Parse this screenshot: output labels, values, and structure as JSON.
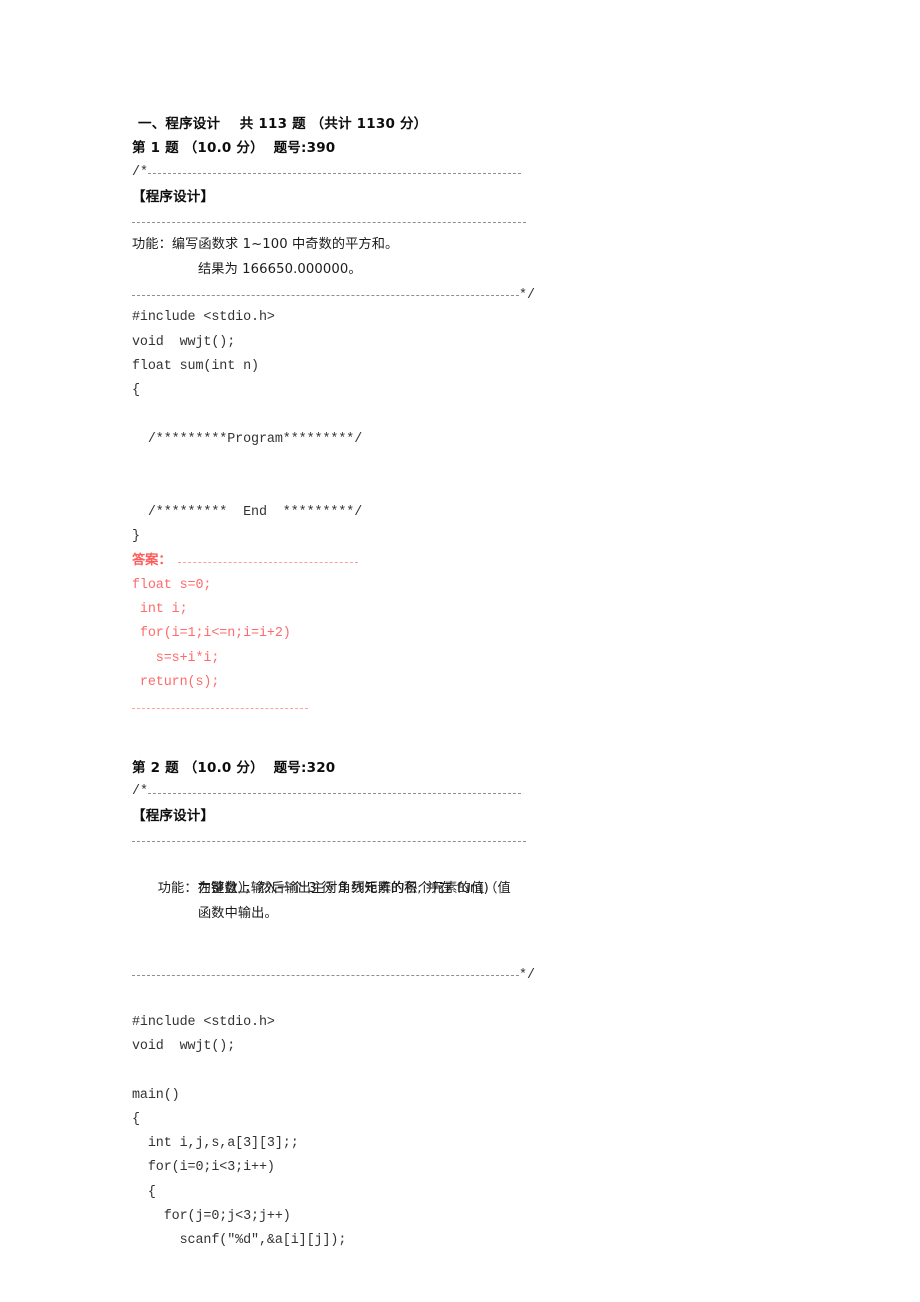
{
  "document": {
    "section_heading": {
      "label_prefix": "一、程序设计",
      "count_text": "共 113 题",
      "total_text": "（共计 1130 分）",
      "full": "一、程序设计    共 113 题 （共计 1130 分）"
    },
    "colors": {
      "body_text": "#1a1a1a",
      "code_text": "#333333",
      "answer_text": "#ff6b6b",
      "answer_label": "#ff5c5c",
      "rule_gray": "#8f8f8f",
      "rule_red": "#ffa0a0",
      "page_background": "#ffffff"
    },
    "problems": [
      {
        "title": "第 1 题 （10.0 分）  题号:390",
        "number_label": "第 1 题",
        "score_label": "（10.0 分）",
        "id_label": "题号:390",
        "comment_open": "/*",
        "tag": "【程序设计】",
        "comment_close": "*/",
        "spec_lines": [
          "功能：编写函数求 1~100 中奇数的平方和。",
          "结果为 166650.000000。"
        ],
        "spec_label": "功能：",
        "spec_body_1": "编写函数求 1~100 中奇数的平方和。",
        "spec_body_2": "结果为 166650.000000。",
        "code_lines": [
          "#include <stdio.h>",
          "void  wwjt();",
          "float sum(int n)",
          "{",
          "  /*********Program*********/",
          "",
          "  /*********  End  *********/",
          "}"
        ],
        "answer_label": "答案：",
        "answer_lines": [
          "float s=0;",
          " int i;",
          " for(i=1;i<=n;i=i+2)",
          "   s=s+i*i;",
          " return(s);"
        ]
      },
      {
        "title": "第 2 题 （10.0 分）  题号:320",
        "number_label": "第 2 题",
        "score_label": "（10.0 分）",
        "id_label": "题号:320",
        "comment_open": "/*",
        "tag": "【程序设计】",
        "comment_close": "*/",
        "spec_label": "功能：",
        "spec_body_1": "在键盘上输入一个 3 行 3 列矩阵的各个元素的值（值",
        "spec_body_2": "为整数），然后输出主对角线元素的积, 并在 fun()",
        "spec_body_3": "函数中输出。",
        "code_lines": [
          "#include <stdio.h>",
          "void  wwjt();",
          "",
          "main()",
          "{",
          "  int i,j,s,a[3][3];;",
          "  for(i=0;i<3;i++)",
          "  {",
          "    for(j=0;j<3;j++)",
          "      scanf(\"%d\",&a[i][j]);"
        ]
      }
    ]
  }
}
